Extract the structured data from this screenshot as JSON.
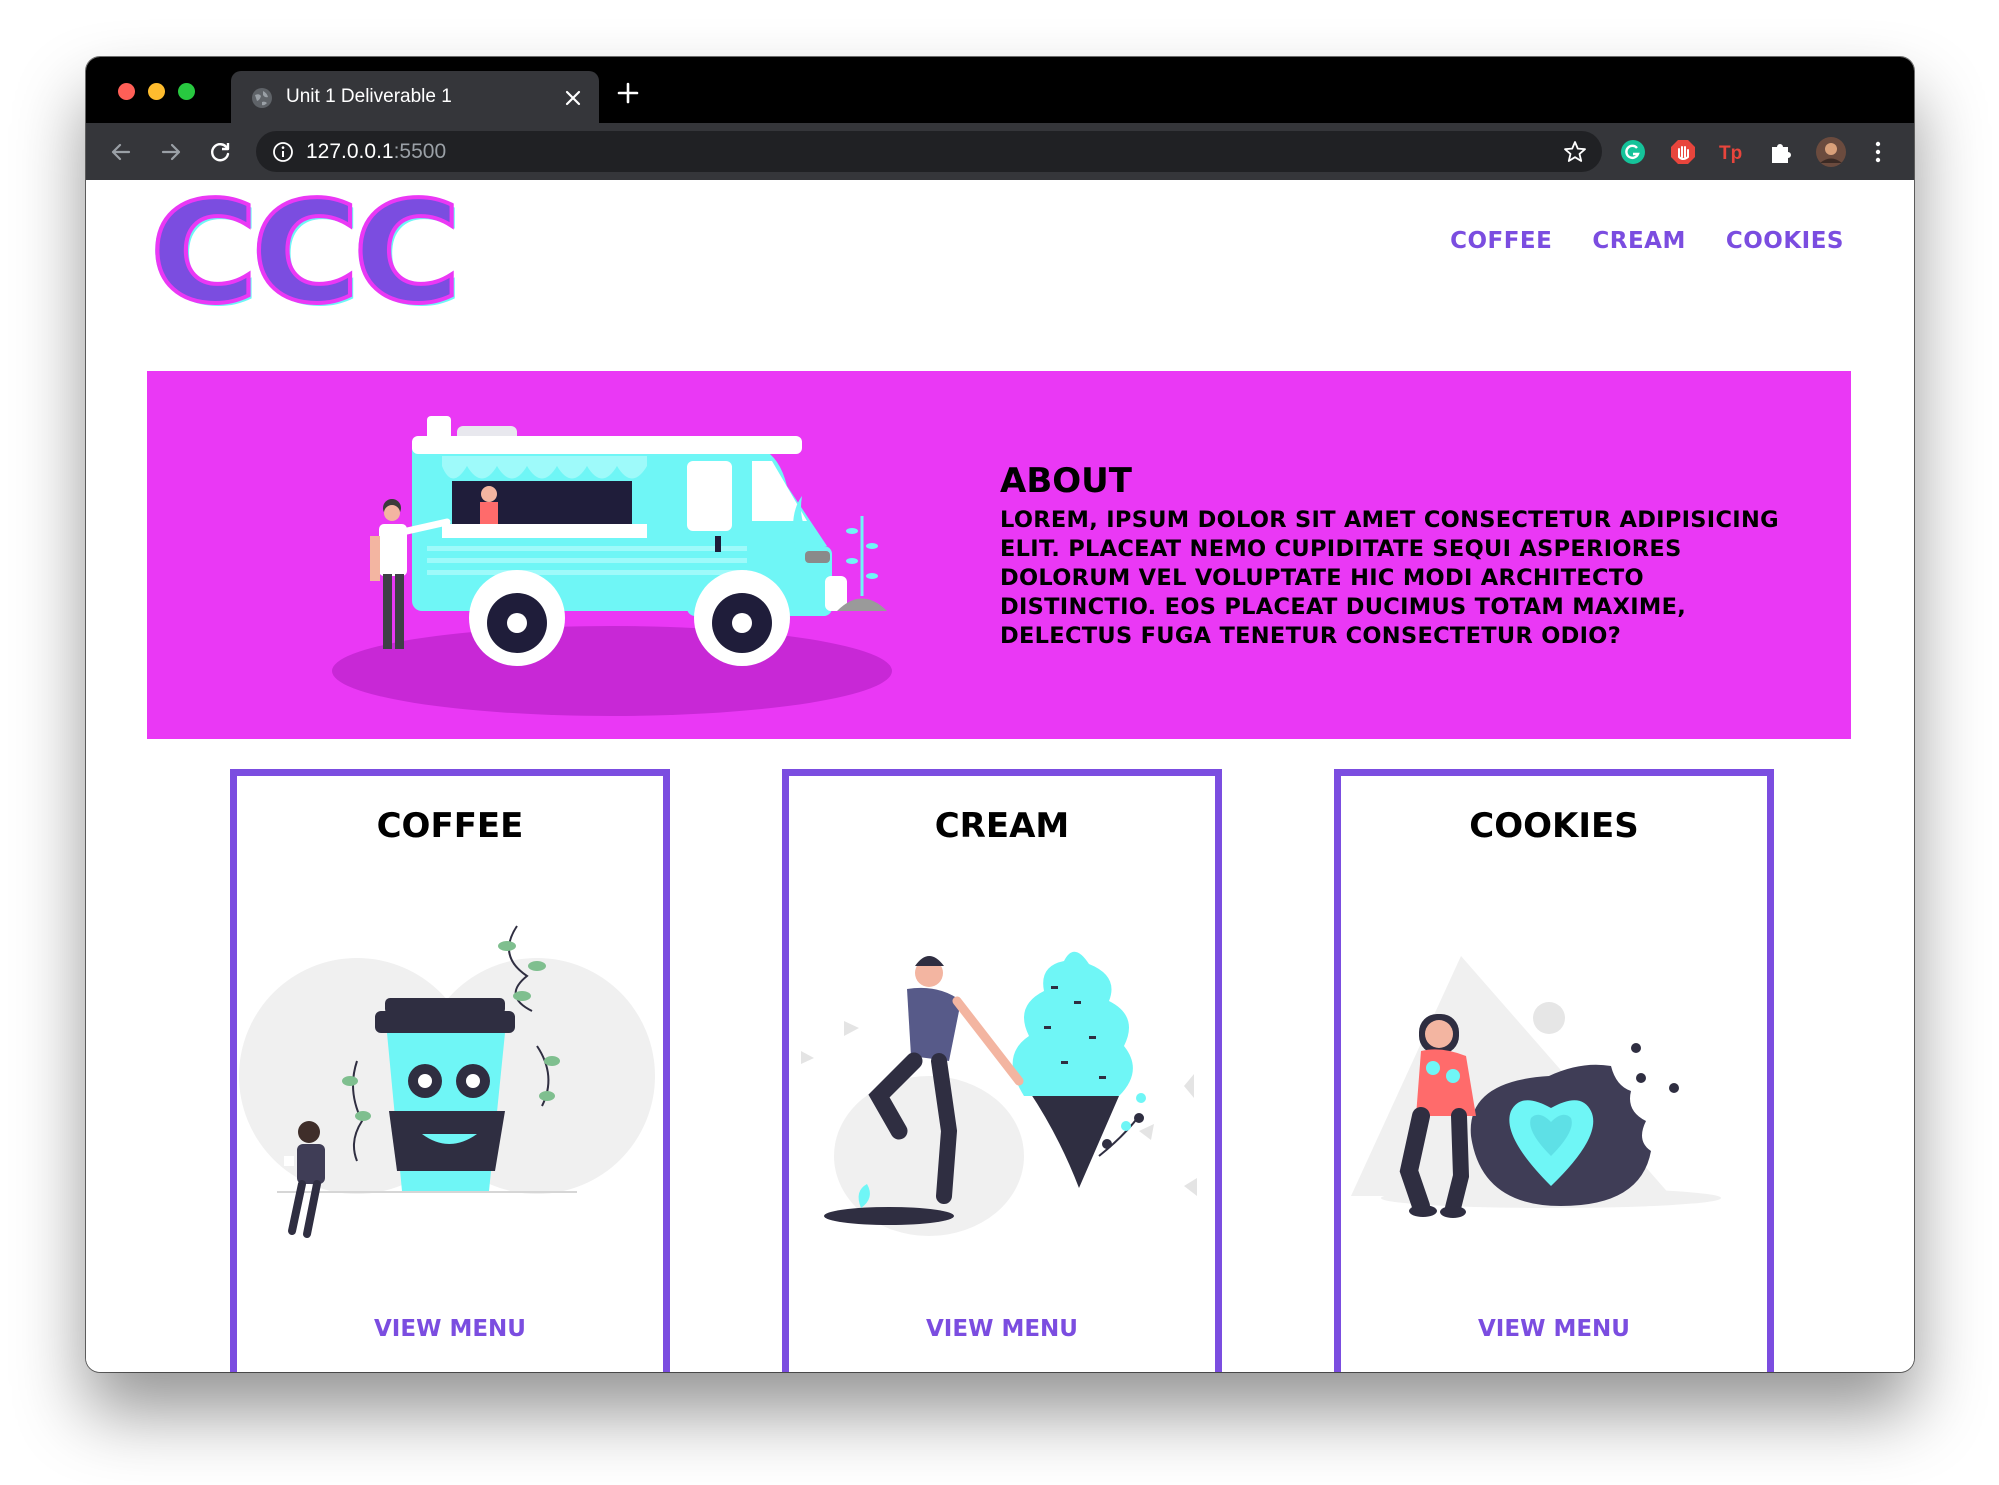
{
  "browser": {
    "tab_title": "Unit 1 Deliverable 1",
    "url_host": "127.0.0.1",
    "url_port": ":5500"
  },
  "site": {
    "logo": "CCC",
    "nav": [
      "COFFEE",
      "CREAM",
      "COOKIES"
    ]
  },
  "about": {
    "title": "ABOUT",
    "text": "Lorem, ipsum dolor sit amet consectetur adipisicing elit. Placeat nemo cupiditate sequi asperiores dolorum vel voluptate hic modi architecto distinctio. Eos placeat ducimus totam maxime, delectus fuga tenetur consectetur odio?"
  },
  "cards": [
    {
      "title": "COFFEE",
      "link": "VIEW MENU"
    },
    {
      "title": "CREAM",
      "link": "VIEW MENU"
    },
    {
      "title": "COOKIES",
      "link": "VIEW MENU"
    }
  ],
  "colors": {
    "accent": "#7b4de0",
    "hero": "#ea38f5",
    "cyan": "#6ff6f6"
  }
}
